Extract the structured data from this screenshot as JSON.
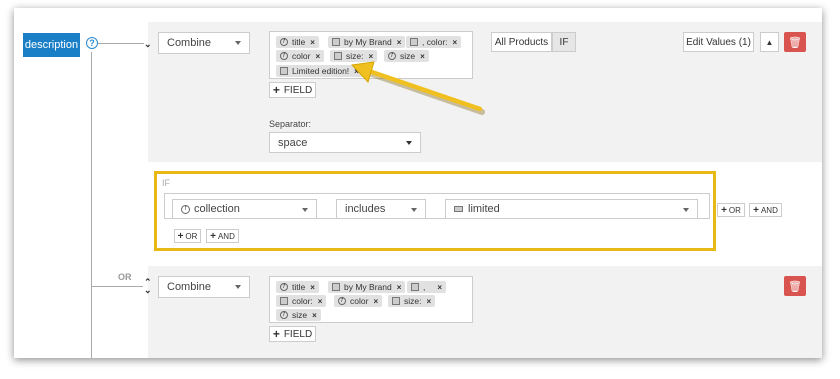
{
  "description_button": "description",
  "help_icon": "?",
  "section1": {
    "mode": "Combine",
    "tags_row1": [
      {
        "icon": "function-icon",
        "label": "title"
      },
      {
        "icon": "text-icon",
        "label": "by My Brand"
      },
      {
        "icon": "text-icon",
        "label": ", color:"
      }
    ],
    "tags_row2": [
      {
        "icon": "function-icon",
        "label": "color"
      },
      {
        "icon": "text-icon",
        "label": "size:"
      },
      {
        "icon": "function-icon",
        "label": "size"
      }
    ],
    "tags_row3": [
      {
        "icon": "text-icon",
        "label": "Limited edition!"
      }
    ],
    "field_button": "FIELD",
    "all_products": "All Products",
    "if_button": "IF",
    "edit_values": "Edit Values (1)",
    "separator_label": "Separator:",
    "separator_value": "space"
  },
  "condition": {
    "if_label": "IF",
    "field": "collection",
    "operator": "includes",
    "value": "limited",
    "or_label": "OR",
    "and_label": "AND"
  },
  "or_separator": "OR",
  "section2": {
    "mode": "Combine",
    "tags_row1": [
      {
        "icon": "function-icon",
        "label": "title"
      },
      {
        "icon": "text-icon",
        "label": "by My Brand"
      },
      {
        "icon": "text-icon",
        "label": ","
      }
    ],
    "tags_row2": [
      {
        "icon": "text-icon",
        "label": "color:"
      },
      {
        "icon": "function-icon",
        "label": "color"
      },
      {
        "icon": "text-icon",
        "label": "size:"
      }
    ],
    "tags_row3": [
      {
        "icon": "function-icon",
        "label": "size"
      }
    ],
    "field_button": "FIELD"
  },
  "colors": {
    "primary": "#1a7fc7",
    "danger": "#d9534f",
    "highlight": "#e8b816"
  }
}
